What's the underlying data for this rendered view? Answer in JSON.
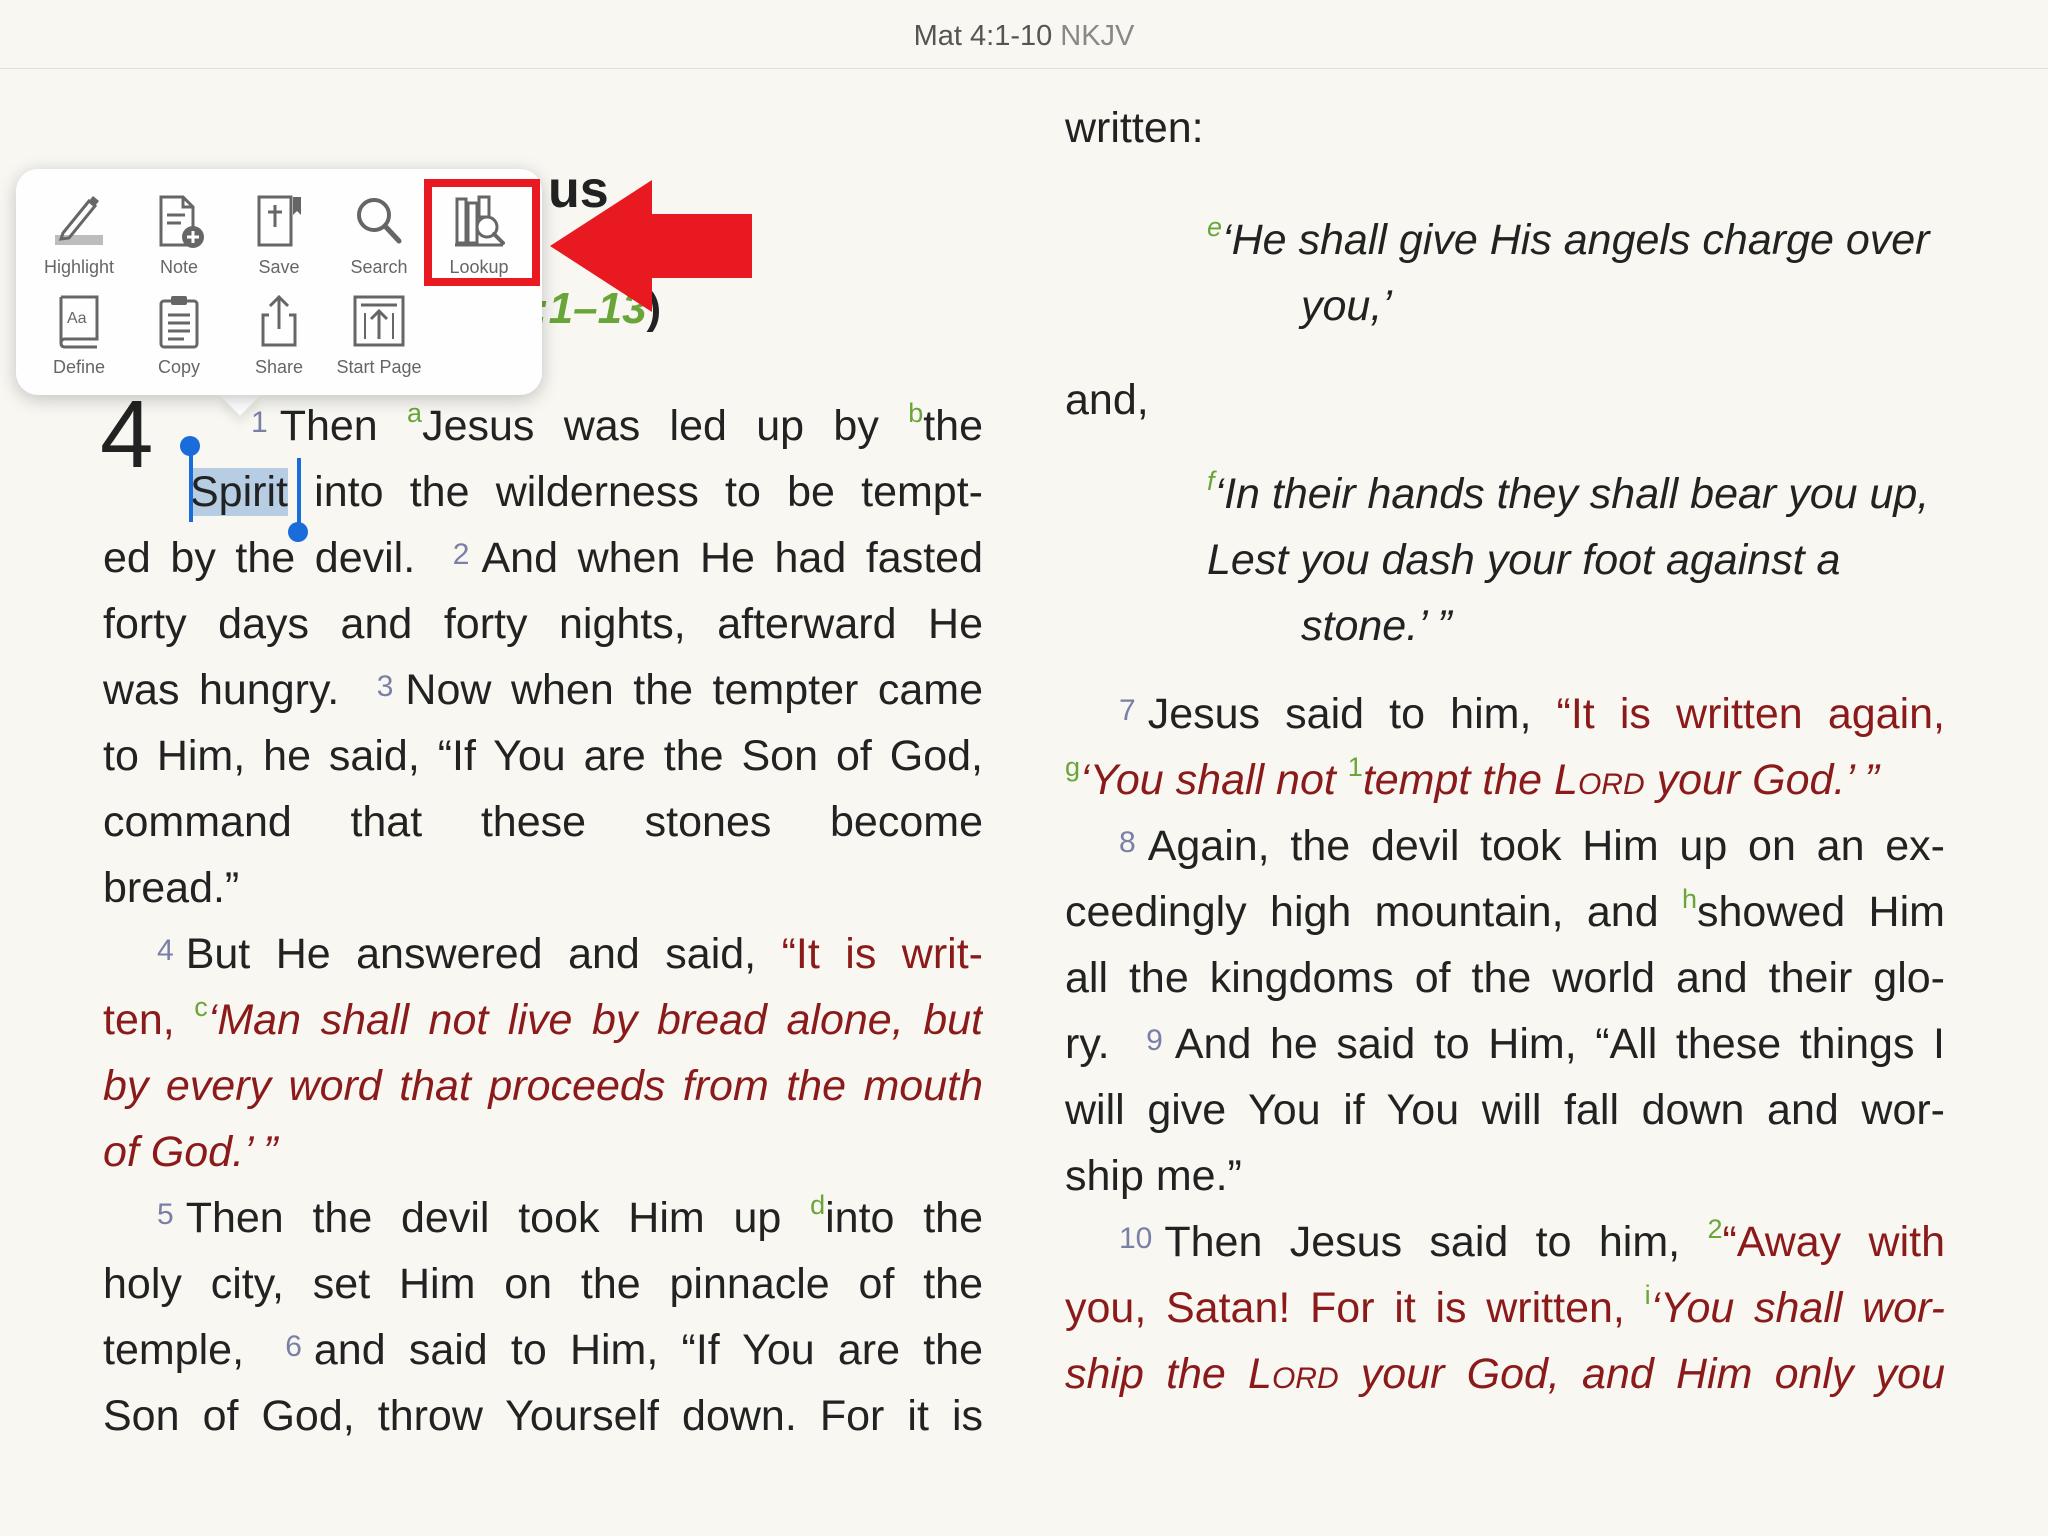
{
  "header": {
    "reference": "Mat 4:1-10",
    "version": "NKJV"
  },
  "popup": {
    "row1": [
      "Highlight",
      "Note",
      "Save",
      "Search",
      "Lookup"
    ],
    "row2": [
      "Define",
      "Copy",
      "Share",
      "Start Page"
    ]
  },
  "heading": {
    "title_fragment": "us",
    "ref_fragment": ":1–13",
    "paren": ")"
  },
  "chapter_number": "4",
  "selected_word": "Spirit",
  "left": {
    "l1": {
      "v": "1",
      "t1": "Then ",
      "fa": "a",
      "t2": "Jesus was led up by ",
      "fb": "b",
      "t3": "the"
    },
    "l2": " into the wilderness to be tempt-",
    "l3a": "ed by the devil.",
    "v2": "2",
    "l3b": "And when He had fasted",
    "l4": "forty days and forty nights, afterward He",
    "l5a": "was hungry.",
    "v3": "3",
    "l5b": "Now when the tempter came",
    "l6": "to Him, he said, “If You are the Son of God,",
    "l7": "command that these stones become",
    "l8": "bread.”",
    "v4": "4",
    "l9a": "But He answered and said, ",
    "l9b": "“It is writ-",
    "l10a": "ten, ",
    "fc": "c",
    "l10b": "‘Man shall not live by bread alone, but",
    "l11": "by every word that proceeds from the mouth",
    "l12": "of God.’ ”",
    "v5": "5",
    "l13a": "Then the devil took Him up ",
    "fd": "d",
    "l13b": "into the",
    "l14": "holy city, set Him on the pinnacle of the",
    "l15a": "temple,",
    "v6": "6",
    "l15b": "and said to Him, “If You are the",
    "l16": "Son of God, throw Yourself down. For it is"
  },
  "right": {
    "r1": "written:",
    "fe": "e",
    "q1a": "‘He shall give His angels charge over",
    "q1b": "you,’",
    "and": "and,",
    "ff": "f",
    "q2a": "‘In their hands they shall bear you up,",
    "q2b": "Lest you dash your foot against a",
    "q2c": "stone.’ ”",
    "v7": "7",
    "r7a": "Jesus said to him, ",
    "r7b": "“It is written again,",
    "fg": "g",
    "r8a": "‘You shall not ",
    "f1": "1",
    "r8b": "tempt the ",
    "r8lord": "Lord",
    "r8c": " your God.’ ”",
    "v8": "8",
    "r9": "Again, the devil took Him up on an ex-",
    "r10a": "ceedingly high mountain, and ",
    "fh": "h",
    "r10b": "showed Him",
    "r11": "all the kingdoms of the world and their glo-",
    "r12a": "ry.",
    "v9": "9",
    "r12b": "And he said to Him, “All these things I",
    "r13": "will give You if You will fall down and wor-",
    "r14": "ship me.”",
    "v10": "10",
    "r15a": "Then Jesus said to him, ",
    "f2": "2",
    "r15b": "“Away with",
    "r16a": "you, Satan! For it is written, ",
    "fi": "i",
    "r16b": "‘You shall wor-",
    "r17a": "ship the ",
    "r17lord": "Lord",
    "r17b": " your God, and Him only you"
  }
}
